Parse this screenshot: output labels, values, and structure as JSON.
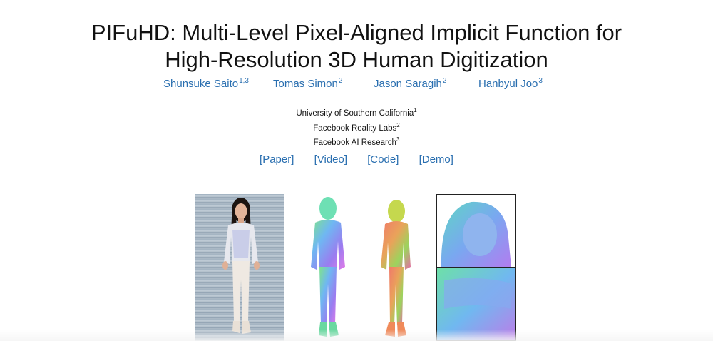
{
  "title": {
    "line1": "PIFuHD: Multi-Level Pixel-Aligned Implicit Function for",
    "line2": "High-Resolution 3D Human Digitization"
  },
  "authors": [
    {
      "name": "Shunsuke Saito",
      "sup": "1,3"
    },
    {
      "name": "Tomas Simon",
      "sup": "2"
    },
    {
      "name": "Jason Saragih",
      "sup": "2"
    },
    {
      "name": "Hanbyul Joo",
      "sup": "3"
    }
  ],
  "affiliations": [
    {
      "name": "University of Southern California",
      "sup": "1"
    },
    {
      "name": "Facebook Reality Labs",
      "sup": "2"
    },
    {
      "name": "Facebook AI Research",
      "sup": "3"
    }
  ],
  "links": {
    "paper": "[Paper]",
    "video": "[Video]",
    "code": "[Code]",
    "demo": "[Demo]"
  },
  "colors": {
    "link": "#2a6fb0",
    "text": "#111111"
  }
}
